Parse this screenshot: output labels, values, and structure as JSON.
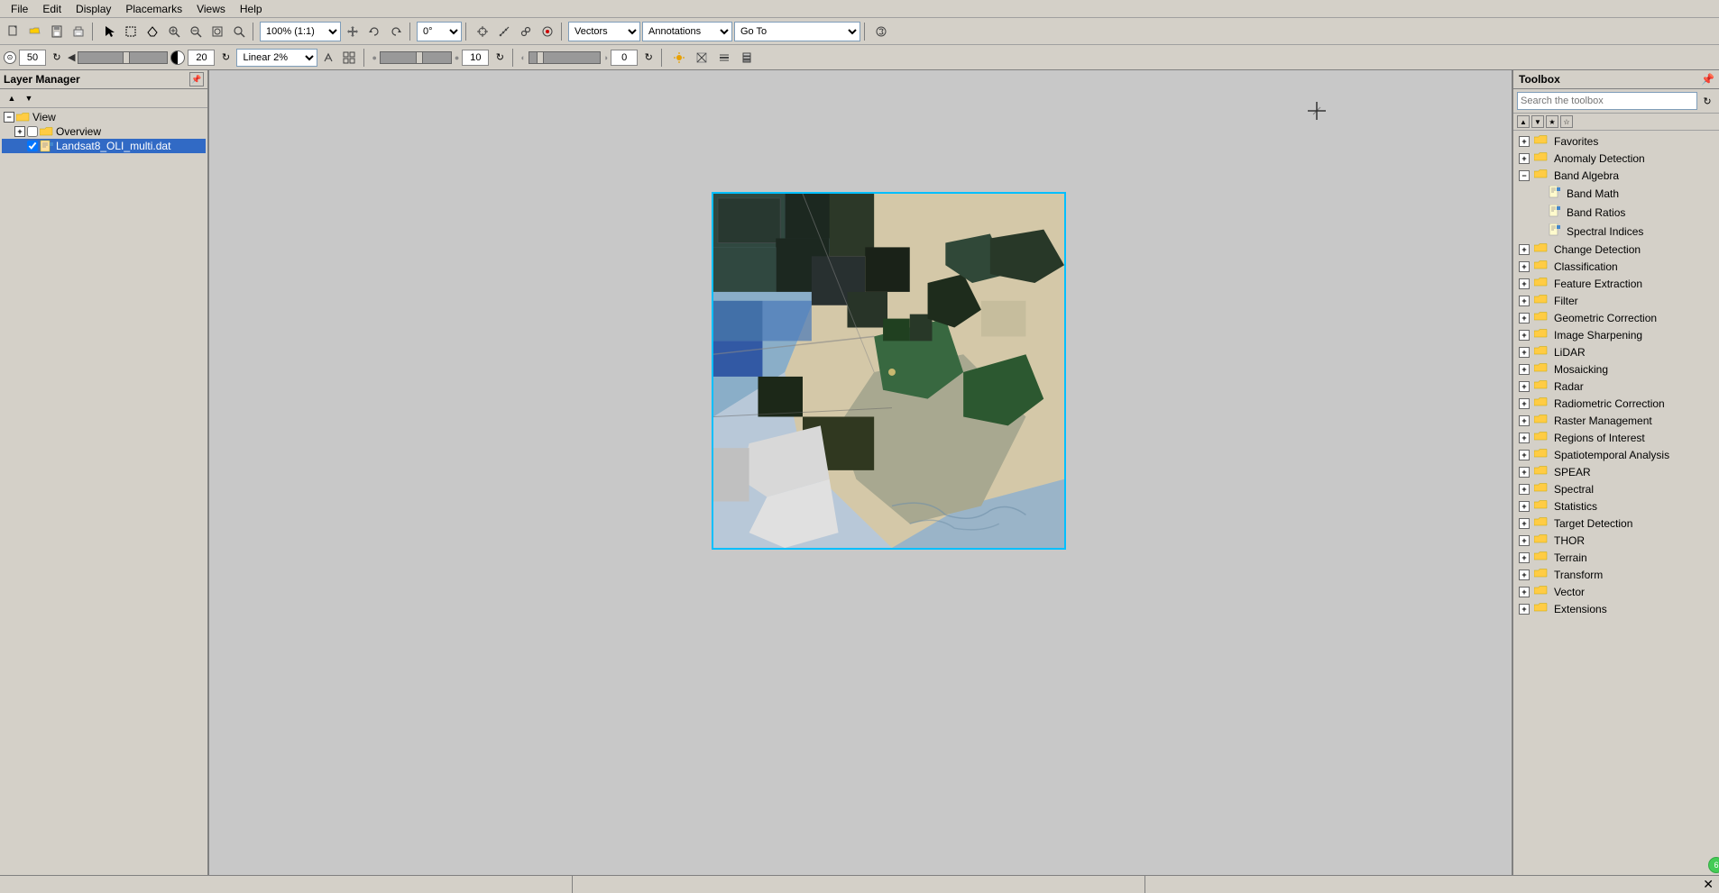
{
  "menubar": {
    "items": [
      "File",
      "Edit",
      "Display",
      "Placemarks",
      "Views",
      "Help"
    ]
  },
  "toolbar1": {
    "zoom_value": "100% (1:1)",
    "rotation": "0°",
    "vectors_label": "Vectors",
    "annotations_label": "Annotations",
    "goto_label": "Go To"
  },
  "toolbar2": {
    "linear_label": "Linear 2%",
    "val1": "50",
    "val2": "20",
    "val3": "10",
    "val4": "0"
  },
  "layer_manager": {
    "title": "Layer Manager",
    "tree": {
      "view_label": "View",
      "overview_label": "Overview",
      "landsat_label": "Landsat8_OLI_multi.dat"
    }
  },
  "toolbox": {
    "title": "Toolbox",
    "search_placeholder": "Search the toolbox",
    "items": [
      {
        "label": "Favorites",
        "type": "folder",
        "indent": 0,
        "expand": "plus"
      },
      {
        "label": "Anomaly Detection",
        "type": "folder",
        "indent": 0,
        "expand": "plus"
      },
      {
        "label": "Band Algebra",
        "type": "folder",
        "indent": 0,
        "expand": "minus"
      },
      {
        "label": "Band Math",
        "type": "file",
        "indent": 1,
        "expand": "none"
      },
      {
        "label": "Band Ratios",
        "type": "file",
        "indent": 1,
        "expand": "none"
      },
      {
        "label": "Spectral Indices",
        "type": "file",
        "indent": 1,
        "expand": "none"
      },
      {
        "label": "Change Detection",
        "type": "folder",
        "indent": 0,
        "expand": "plus"
      },
      {
        "label": "Classification",
        "type": "folder",
        "indent": 0,
        "expand": "plus"
      },
      {
        "label": "Feature Extraction",
        "type": "folder",
        "indent": 0,
        "expand": "plus"
      },
      {
        "label": "Filter",
        "type": "folder",
        "indent": 0,
        "expand": "plus"
      },
      {
        "label": "Geometric Correction",
        "type": "folder",
        "indent": 0,
        "expand": "plus"
      },
      {
        "label": "Image Sharpening",
        "type": "folder",
        "indent": 0,
        "expand": "plus"
      },
      {
        "label": "LiDAR",
        "type": "folder",
        "indent": 0,
        "expand": "plus"
      },
      {
        "label": "Mosaicking",
        "type": "folder",
        "indent": 0,
        "expand": "plus"
      },
      {
        "label": "Radar",
        "type": "folder",
        "indent": 0,
        "expand": "plus"
      },
      {
        "label": "Radiometric Correction",
        "type": "folder",
        "indent": 0,
        "expand": "plus"
      },
      {
        "label": "Raster Management",
        "type": "folder",
        "indent": 0,
        "expand": "plus"
      },
      {
        "label": "Regions of Interest",
        "type": "folder",
        "indent": 0,
        "expand": "plus"
      },
      {
        "label": "Spatiotemporal Analysis",
        "type": "folder",
        "indent": 0,
        "expand": "plus"
      },
      {
        "label": "SPEAR",
        "type": "folder",
        "indent": 0,
        "expand": "plus"
      },
      {
        "label": "Spectral",
        "type": "folder",
        "indent": 0,
        "expand": "plus"
      },
      {
        "label": "Statistics",
        "type": "folder",
        "indent": 0,
        "expand": "plus"
      },
      {
        "label": "Target Detection",
        "type": "folder",
        "indent": 0,
        "expand": "plus"
      },
      {
        "label": "THOR",
        "type": "folder",
        "indent": 0,
        "expand": "plus"
      },
      {
        "label": "Terrain",
        "type": "folder",
        "indent": 0,
        "expand": "plus"
      },
      {
        "label": "Transform",
        "type": "folder",
        "indent": 0,
        "expand": "plus"
      },
      {
        "label": "Vector",
        "type": "folder",
        "indent": 0,
        "expand": "plus"
      },
      {
        "label": "Extensions",
        "type": "folder",
        "indent": 0,
        "expand": "plus"
      }
    ]
  },
  "statusbar": {
    "seg1": "",
    "seg2": "",
    "seg3": ""
  },
  "icons": {
    "folder": "📁",
    "file": "📄",
    "open_folder": "📂",
    "search": "🔍",
    "plus": "+",
    "minus": "−",
    "pin": "📌",
    "refresh": "↻",
    "close": "✕"
  }
}
